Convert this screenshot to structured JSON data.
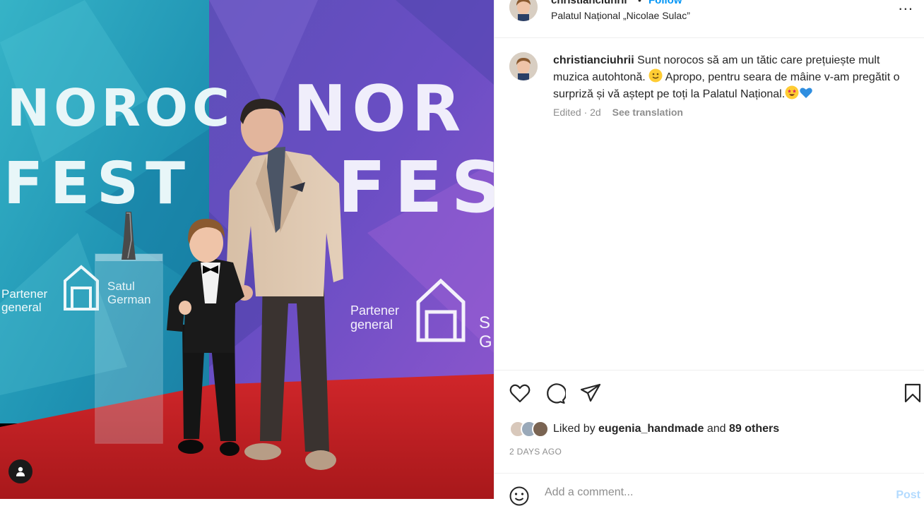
{
  "post": {
    "username": "christianciuhrii",
    "follow_label": "Follow",
    "location": "Palatul Național „Nicolae Sulac”",
    "more_label": "...",
    "caption": {
      "username": "christianciuhrii",
      "text_1": " Sunt norocos să am un tătic care prețuiește mult muzica autohtonă. ",
      "text_2": " Apropo, pentru seara de mâine v-am pregătit o surpriză și vă aștept pe toți la Palatul Național.",
      "emojis": [
        "slightly-smiling-face",
        "star-struck-face",
        "blue-heart"
      ]
    },
    "meta": {
      "edited": "Edited · 2d",
      "translate": "See translation"
    },
    "likes": {
      "prefix": "Liked by",
      "user": "eugenia_handmade",
      "and": "and",
      "others": "89 others"
    },
    "date": "2 DAYS AGO",
    "comment": {
      "placeholder": "Add a comment...",
      "post_label": "Post"
    }
  },
  "media": {
    "backdrop_left_text": [
      "NOROC",
      "FEST"
    ],
    "backdrop_right_text": [
      "NOR",
      "FES"
    ],
    "sponsor_left": [
      "Partener",
      "general"
    ],
    "sponsor_left_brand": [
      "Satul",
      "German"
    ],
    "sponsor_right": [
      "Partener",
      "general"
    ],
    "sponsor_right_brand": [
      "S",
      "G"
    ]
  },
  "icons": {
    "like": "heart-icon",
    "comment": "comment-icon",
    "share": "share-icon",
    "save": "bookmark-icon",
    "more": "more-icon",
    "emoji": "emoji-icon",
    "tagged": "user-tag-icon"
  },
  "colors": {
    "follow": "#0095f6",
    "muted": "#8e8e8e",
    "post_disabled": "#b3dbff",
    "carpet": "#c21d1f"
  }
}
